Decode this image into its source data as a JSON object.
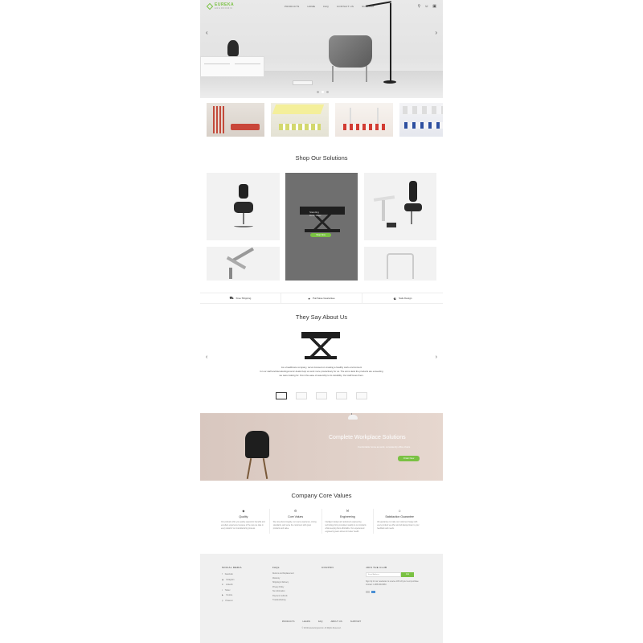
{
  "header": {
    "logo_name": "EUREKA",
    "logo_sub": "ERGONOMIC",
    "nav": [
      "PRODUCTS",
      "HOME",
      "FAQ",
      "CONTACT US",
      "SUPPORT"
    ],
    "icons": [
      "search-icon",
      "user-icon",
      "cart-icon"
    ]
  },
  "hero": {
    "slides": 3,
    "active_slide": 2
  },
  "thumbnails": [
    "office-scene-1",
    "office-scene-2",
    "office-scene-3",
    "office-scene-4"
  ],
  "solutions": {
    "title": "Shop Our Solutions",
    "featured": {
      "line1": "Standing",
      "line2": "Desk Riser",
      "button": "Shop Now"
    }
  },
  "features": [
    {
      "icon": "truck-icon",
      "label": "Free Shipping"
    },
    {
      "icon": "shield-icon",
      "label": "Purchase Guarantee"
    },
    {
      "icon": "headset-icon",
      "label": "Safe Design"
    }
  ],
  "testimonials": {
    "title": "They Say About Us",
    "text": [
      "As a healthcare company, we've focused on creating a healthy work environment",
      "for our staff and Eureka Ergonomic desks help us work more productively for us. The arms desk the products are exceeding",
      "we were looking for. From the ease of assembly to its durability. Our staff loves them."
    ],
    "thumbs": 5,
    "active_thumb": 0
  },
  "banner": {
    "title": "Complete Workplace Solutions",
    "subtitle": "Comfortable home as work, consistently office chairs",
    "button": "Order Now"
  },
  "values": {
    "title": "Company Core Values",
    "items": [
      {
        "icon": "diamond-icon",
        "heading": "Quality",
        "text": "Our products offer you quality ergonomic benefits and excellent experience because of the care we take in every detail of our manufacturing process."
      },
      {
        "icon": "gear-icon",
        "heading": "Core Values",
        "text": "We care about integrity, our users experience, strong standards, and serve the customers with great products and value."
      },
      {
        "icon": "wrench-icon",
        "heading": "Engineering",
        "text": "Intelligent design and advanced engineering technology bring consistent quality to our products while keeping them affordable. Our experienced engineering team strives for better health."
      },
      {
        "icon": "smile-icon",
        "heading": "Satisfaction Guarantee",
        "text": "We guarantee to make our customers happy with every product we offer and will always listen to your feedback and needs."
      }
    ]
  },
  "footer": {
    "social": {
      "heading": "SOCIAL MEDIA",
      "items": [
        {
          "icon": "facebook-icon",
          "label": "Facebook"
        },
        {
          "icon": "instagram-icon",
          "label": "Instagram"
        },
        {
          "icon": "linkedin-icon",
          "label": "LinkedIn"
        },
        {
          "icon": "twitter-icon",
          "label": "Twitter"
        },
        {
          "icon": "youtube-icon",
          "label": "Youtube"
        },
        {
          "icon": "pinterest-icon",
          "label": "Pinterest"
        }
      ]
    },
    "faq": {
      "heading": "FAQs",
      "items": [
        "Returns and Replacement",
        "Warranty",
        "Shipping & Delivery",
        "Privacy Policy",
        "Tax information",
        "Payment methods",
        "Troubleshooting"
      ]
    },
    "col3": {
      "heading": "COUPON"
    },
    "subscribe": {
      "heading": "JOIN THE CLUB",
      "placeholder": "Email Address",
      "button": "Join",
      "note": "Sign Up for our newsletter to receive 10% off your next purchase",
      "phone": "Contact: 1-888-600-8963"
    },
    "nav": [
      "PRODUCTS",
      "LEARN",
      "FAQ",
      "ABOUT US",
      "SUPPORT"
    ],
    "copyright": "© 2019 Eureka Ergonomic. All Rights Reserved."
  }
}
